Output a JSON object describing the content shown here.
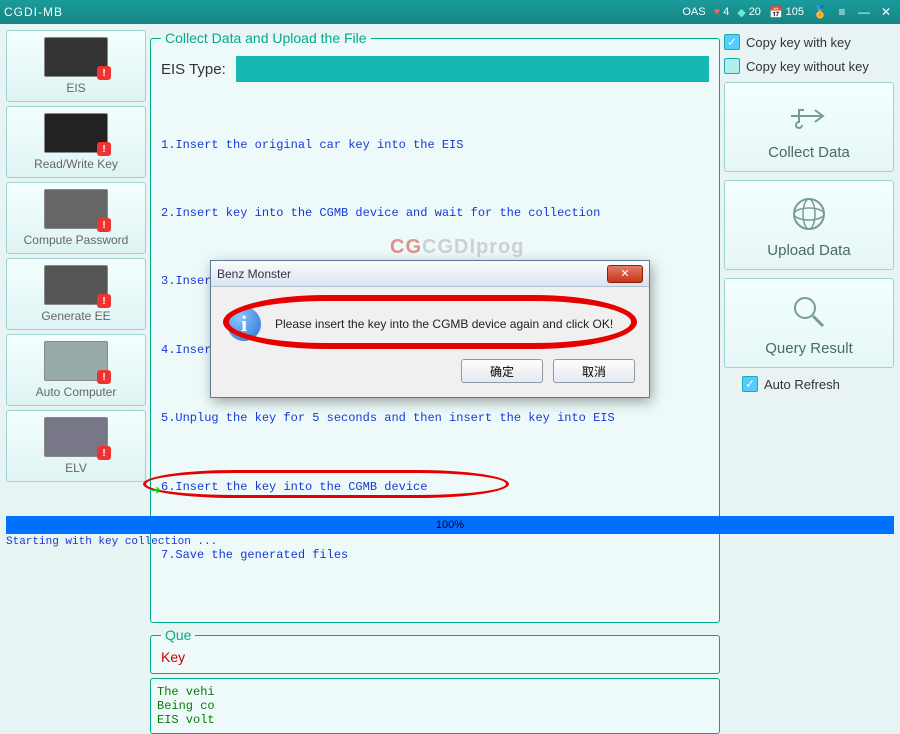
{
  "titlebar": {
    "app_name": "CGDI-MB",
    "oas": "OAS",
    "hearts": "4",
    "diamonds": "20",
    "cal": "105"
  },
  "sidebar": [
    {
      "label": "EIS"
    },
    {
      "label": "Read/Write Key"
    },
    {
      "label": "Compute Password"
    },
    {
      "label": "Generate EE"
    },
    {
      "label": "Auto Computer"
    },
    {
      "label": "ELV"
    }
  ],
  "collect": {
    "legend": "Collect Data and Upload the File",
    "eis_type_label": "EIS Type:",
    "steps": [
      "1.Insert the original car key into the EIS",
      "2.Insert key into the CGMB device and wait for the collection",
      "3.Insert the car key into the EIS 10s and dial out",
      "4.Insert the key into the EIS",
      "5.Unplug the key for 5 seconds and then insert the key into EIS",
      "6.Insert the key into the CGMB device",
      "7.Save the generated files"
    ]
  },
  "qa": {
    "legend": "Que",
    "key_label": "Key"
  },
  "console_lines": "The vehi\nBeing co\nEIS volt",
  "right": {
    "copy_with": "Copy key with key",
    "copy_without": "Copy key without key",
    "collect": "Collect Data",
    "upload": "Upload  Data",
    "query": "Query Result",
    "auto_refresh": "Auto Refresh"
  },
  "progress": {
    "pct": 100,
    "label": "100%"
  },
  "status_line": "Starting with key collection ...",
  "dialog": {
    "title": "Benz Monster",
    "message": "Please insert the key into the CGMB device again and click OK!",
    "ok": "确定",
    "cancel": "取消"
  },
  "watermark_a": "CG",
  "watermark_b": "CGDIprog"
}
